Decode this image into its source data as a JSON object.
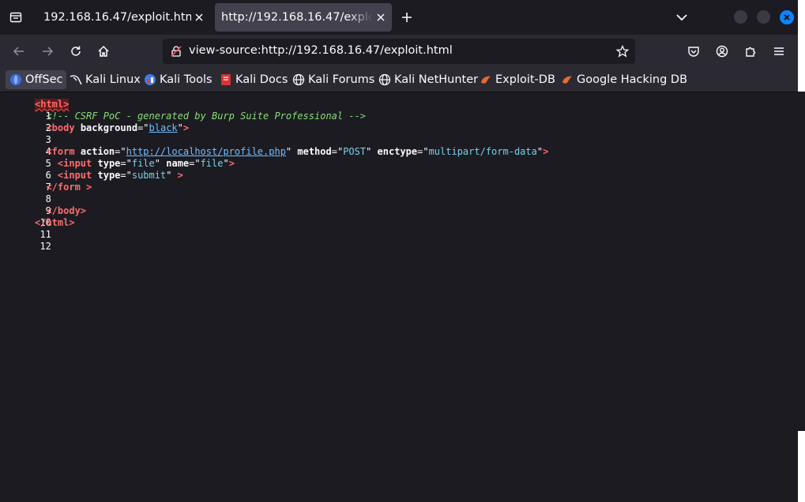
{
  "tabs": [
    {
      "title": "192.168.16.47/exploit.html",
      "active": false
    },
    {
      "title": "http://192.168.16.47/exploit.h",
      "active": true
    }
  ],
  "urlbar": {
    "url": "view-source:http://192.168.16.47/exploit.html"
  },
  "bookmarks": [
    {
      "label": "OffSec",
      "icon": "offsec-icon"
    },
    {
      "label": "Kali Linux",
      "icon": "kali-dragon-icon"
    },
    {
      "label": "Kali Tools",
      "icon": "kali-tools-icon"
    },
    {
      "label": "Kali Docs",
      "icon": "kali-docs-icon"
    },
    {
      "label": "Kali Forums",
      "icon": "globe-icon"
    },
    {
      "label": "Kali NetHunter",
      "icon": "globe-icon"
    },
    {
      "label": "Exploit-DB",
      "icon": "exploit-db-icon"
    },
    {
      "label": "Google Hacking DB",
      "icon": "exploit-db-icon"
    }
  ],
  "source": {
    "line_numbers": [
      "1",
      "2",
      "3",
      "4",
      "5",
      "6",
      "7",
      "8",
      "9",
      "10",
      "11",
      "12"
    ],
    "comment": "<!-- CSRF PoC - generated by Burp Suite Professional -->",
    "body_bg": "black",
    "form_action": "http://localhost/profile.php",
    "form_method": "POST",
    "form_enctype": "multipart/form-data",
    "input1_type": "file",
    "input1_name": "file",
    "input2_type": "submit"
  },
  "colors": {
    "tag": "#ff6b6b",
    "comment": "#86de74",
    "value": "#7ad0e8",
    "link": "#75bfff",
    "accent": "#0a84ff"
  }
}
